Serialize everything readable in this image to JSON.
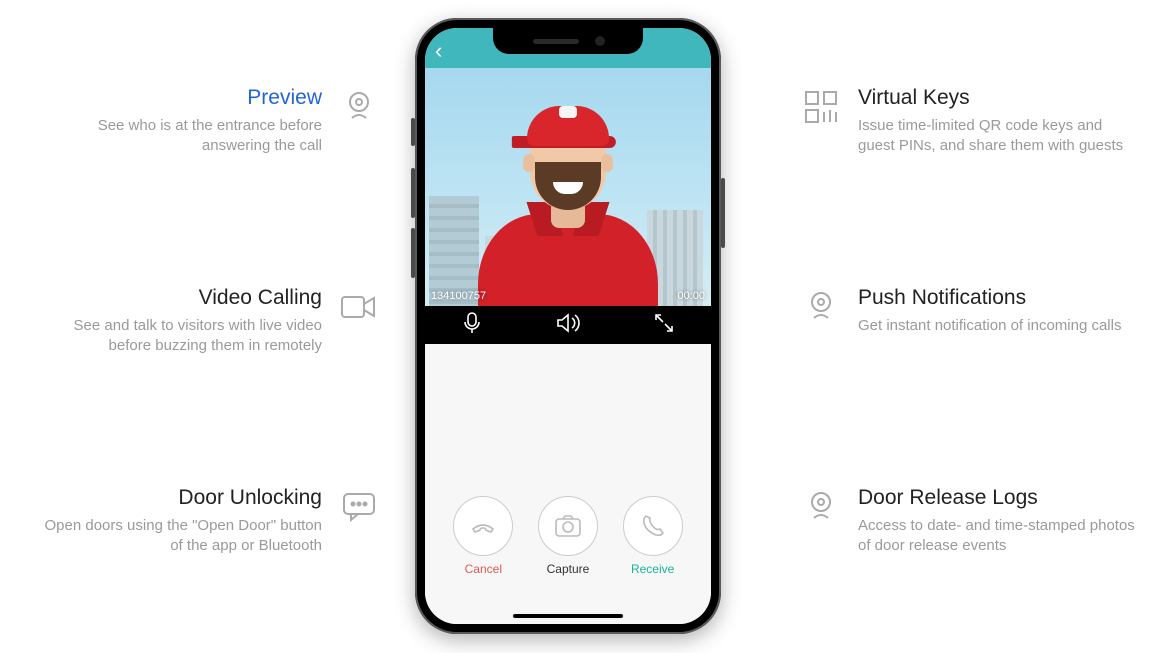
{
  "features_left": [
    {
      "title": "Preview",
      "desc": "See who is at the entrance before answering the call",
      "highlight": true
    },
    {
      "title": "Video Calling",
      "desc": "See and talk to visitors with live video before buzzing them in remotely",
      "highlight": false
    },
    {
      "title": "Door Unlocking",
      "desc": "Open doors using the \"Open Door\" button of the app or Bluetooth",
      "highlight": false
    }
  ],
  "features_right": [
    {
      "title": "Virtual Keys",
      "desc": "Issue time-limited QR code keys and guest PINs, and share them with guests"
    },
    {
      "title": "Push Notifications",
      "desc": "Get instant notification of incoming calls"
    },
    {
      "title": "Door Release Logs",
      "desc": "Access to date- and time-stamped photos of door release events"
    }
  ],
  "phone": {
    "caller_id": "134100757",
    "timer": "00:00",
    "buttons": {
      "cancel": "Cancel",
      "capture": "Capture",
      "receive": "Receive"
    }
  }
}
